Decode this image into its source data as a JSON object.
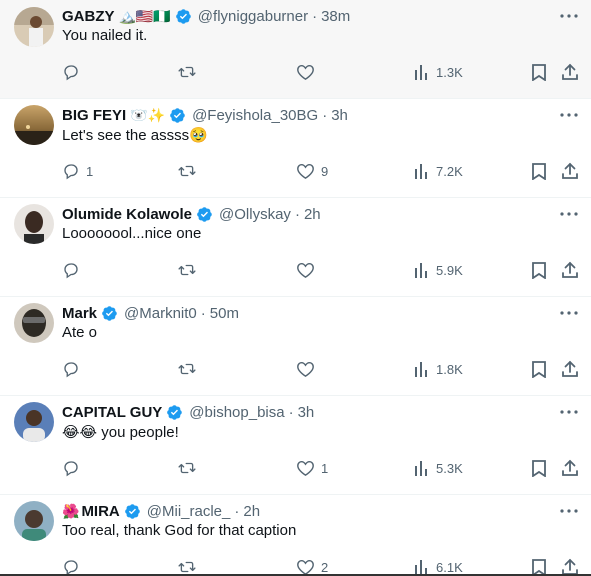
{
  "replies": [
    {
      "name": "GABZY",
      "decoration": "🏔️🇺🇸🇳🇬",
      "handle": "@flyniggaburner",
      "time": "38m",
      "text": "You nailed it.",
      "replies": "",
      "reposts": "",
      "likes": "",
      "views": "1.3K",
      "avatar_color": "#c8b9a6"
    },
    {
      "name": "BIG FEYI",
      "decoration": "🐻‍❄️✨",
      "handle": "@Feyishola_30BG",
      "time": "3h",
      "text": "Let's see the assss🥹",
      "replies": "1",
      "reposts": "",
      "likes": "9",
      "views": "7.2K",
      "avatar_color": "#8a6a3a"
    },
    {
      "name": "Olumide Kolawole",
      "decoration": "",
      "handle": "@Ollyskay",
      "time": "2h",
      "text": "Loooooool...nice one",
      "replies": "",
      "reposts": "",
      "likes": "",
      "views": "5.9K",
      "avatar_color": "#3a2a22"
    },
    {
      "name": "Mark",
      "decoration": "",
      "handle": "@Marknit0",
      "time": "50m",
      "text": "Ate o",
      "replies": "",
      "reposts": "",
      "likes": "",
      "views": "1.8K",
      "avatar_color": "#2e2a24"
    },
    {
      "name": "CAPITAL GUY",
      "decoration": "",
      "handle": "@bishop_bisa",
      "time": "3h",
      "text": "😂😂 you people!",
      "replies": "",
      "reposts": "",
      "likes": "1",
      "views": "5.3K",
      "avatar_color": "#4a6da8"
    },
    {
      "name": "MIRA",
      "decoration": "🌺",
      "handle": "@Mii_racle_",
      "time": "2h",
      "text": "Too real, thank God for that caption",
      "replies": "",
      "reposts": "",
      "likes": "2",
      "views": "6.1K",
      "avatar_color": "#6a8aa0"
    }
  ],
  "colors": {
    "verified": "#1d9bf0",
    "muted": "#536471",
    "text": "#0f1419",
    "hover_bg": "#f7f7f7",
    "divider": "#eff3f4"
  },
  "icons": {
    "reply": "speech-bubble-icon",
    "repost": "repost-arrows-icon",
    "like": "heart-icon",
    "views": "bar-chart-icon",
    "bookmark": "bookmark-icon",
    "share": "share-upload-icon",
    "more": "ellipsis-icon",
    "verified": "verified-badge-icon"
  }
}
